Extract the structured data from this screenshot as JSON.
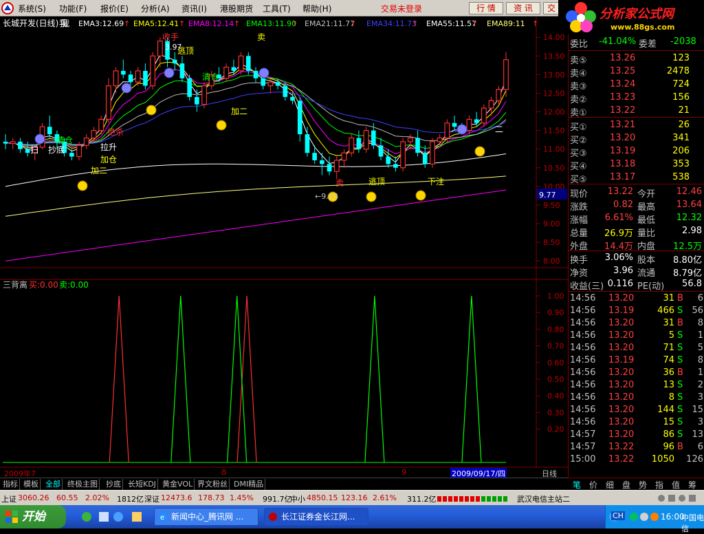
{
  "menubar": {
    "items": [
      "系统(S)",
      "功能(F)",
      "报价(E)",
      "分析(A)",
      "资讯(I)",
      "港股期货",
      "工具(T)",
      "帮助(H)"
    ],
    "login_status": "交易未登录",
    "buttons": [
      "行 情",
      "资 讯",
      "交 易"
    ]
  },
  "brand": {
    "name": "分析家公式网",
    "url": "www.88gs.com"
  },
  "chart": {
    "title": "长城开发(日线) 我",
    "ema_labels": [
      "EMA3:12.69",
      "EMA5:12.41",
      "EMA8:12.14",
      "EMA13:11.90",
      "EMA21:11.77",
      "EMA34:11.73",
      "EMA55:11.57",
      "EMA89:11"
    ],
    "ema_colors": [
      "#ffffff",
      "#ffff00",
      "#ff00ff",
      "#00ff00",
      "#c0c0c0",
      "#4040ff",
      "#ffffff",
      "#ffff80"
    ],
    "price_ticks": [
      "14.00",
      "13.50",
      "13.00",
      "12.50",
      "12.00",
      "11.50",
      "11.00",
      "10.50",
      "10.00",
      "9.50",
      "9.00",
      "8.50",
      "8.00"
    ],
    "current_price_tag": "9.77",
    "high_label": "3.97",
    "low_label": "←9.93",
    "signals": [
      "收手",
      "逃顶",
      "卖",
      "清仓",
      "加二",
      "加仓",
      "拉升",
      "绝杀",
      "抄底",
      "扫",
      "卖",
      "逃顶",
      "二",
      "下注",
      "清仓",
      "加二",
      "我"
    ],
    "indicator": {
      "name": "三背离",
      "sell_label": "买:0.00",
      "buy_label": "卖:0.00",
      "ticks": [
        "1.00",
        "0.90",
        "0.80",
        "0.70",
        "0.60",
        "0.50",
        "0.40",
        "0.30",
        "0.20"
      ]
    },
    "x_labels": [
      "2009年7",
      "8",
      "9",
      "2009/09/17/四"
    ],
    "period": "日线"
  },
  "tabs": [
    "指标",
    "模板",
    "全部",
    "终极主图",
    "抄底",
    "长短KDJ",
    "黄金VOL",
    "界文粉丝",
    "DMI精品"
  ],
  "quote": {
    "ratio": {
      "label1": "委比",
      "val1": "-41.04%",
      "label2": "委差",
      "val2": "-2038"
    },
    "asks": [
      {
        "label": "卖⑤",
        "price": "13.26",
        "vol": "123"
      },
      {
        "label": "卖④",
        "price": "13.25",
        "vol": "2478"
      },
      {
        "label": "卖③",
        "price": "13.24",
        "vol": "724"
      },
      {
        "label": "卖②",
        "price": "13.23",
        "vol": "156"
      },
      {
        "label": "卖①",
        "price": "13.22",
        "vol": "21"
      }
    ],
    "bids": [
      {
        "label": "买①",
        "price": "13.21",
        "vol": "26"
      },
      {
        "label": "买②",
        "price": "13.20",
        "vol": "341"
      },
      {
        "label": "买③",
        "price": "13.19",
        "vol": "206"
      },
      {
        "label": "买④",
        "price": "13.18",
        "vol": "353"
      },
      {
        "label": "买⑤",
        "price": "13.17",
        "vol": "538"
      }
    ],
    "stats1": [
      {
        "l1": "现价",
        "v1": "13.22",
        "c1": "#ff4040",
        "l2": "今开",
        "v2": "12.46",
        "c2": "#ff4040"
      },
      {
        "l1": "涨跌",
        "v1": "0.82",
        "c1": "#ff4040",
        "l2": "最高",
        "v2": "13.64",
        "c2": "#ff4040"
      },
      {
        "l1": "涨幅",
        "v1": "6.61%",
        "c1": "#ff4040",
        "l2": "最低",
        "v2": "12.32",
        "c2": "#00ff00"
      },
      {
        "l1": "总量",
        "v1": "26.9万",
        "c1": "#ffff00",
        "l2": "量比",
        "v2": "2.98",
        "c2": "#ffffff"
      },
      {
        "l1": "外盘",
        "v1": "14.4万",
        "c1": "#ff4040",
        "l2": "内盘",
        "v2": "12.5万",
        "c2": "#00ff00"
      }
    ],
    "stats2": [
      {
        "l1": "换手",
        "v1": "3.06%",
        "l2": "股本",
        "v2": "8.80亿"
      },
      {
        "l1": "净资",
        "v1": "3.96",
        "l2": "流通",
        "v2": "8.79亿"
      },
      {
        "l1": "收益(三)",
        "v1": "0.116",
        "l2": "PE(动)",
        "v2": "56.8"
      }
    ],
    "ticks": [
      {
        "t": "14:56",
        "p": "13.20",
        "v": "31",
        "bs": "B",
        "n": "6"
      },
      {
        "t": "14:56",
        "p": "13.19",
        "v": "466",
        "bs": "S",
        "n": "56"
      },
      {
        "t": "14:56",
        "p": "13.20",
        "v": "31",
        "bs": "B",
        "n": "8"
      },
      {
        "t": "14:56",
        "p": "13.20",
        "v": "5",
        "bs": "S",
        "n": "1"
      },
      {
        "t": "14:56",
        "p": "13.20",
        "v": "71",
        "bs": "S",
        "n": "5"
      },
      {
        "t": "14:56",
        "p": "13.19",
        "v": "74",
        "bs": "S",
        "n": "8"
      },
      {
        "t": "14:56",
        "p": "13.20",
        "v": "36",
        "bs": "B",
        "n": "1"
      },
      {
        "t": "14:56",
        "p": "13.20",
        "v": "13",
        "bs": "S",
        "n": "2"
      },
      {
        "t": "14:56",
        "p": "13.20",
        "v": "8",
        "bs": "S",
        "n": "3"
      },
      {
        "t": "14:56",
        "p": "13.20",
        "v": "144",
        "bs": "S",
        "n": "15"
      },
      {
        "t": "14:56",
        "p": "13.20",
        "v": "15",
        "bs": "S",
        "n": "3"
      },
      {
        "t": "14:57",
        "p": "13.20",
        "v": "86",
        "bs": "S",
        "n": "13"
      },
      {
        "t": "14:57",
        "p": "13.22",
        "v": "96",
        "bs": "B",
        "n": "6"
      },
      {
        "t": "15:00",
        "p": "13.22",
        "v": "1050",
        "bs": "",
        "n": "126"
      }
    ]
  },
  "side_tabs": [
    "笔",
    "价",
    "细",
    "盘",
    "势",
    "指",
    "值",
    "筹"
  ],
  "statusbar": {
    "sh": "上证",
    "sh_idx": "3060.26",
    "sh_chg": "60.55",
    "sh_pct": "2.02%",
    "sh_amt": "1812亿",
    "sz": "深证",
    "sz_idx": "12473.6",
    "sz_chg": "178.73",
    "sz_pct": "1.45%",
    "sz_amt": "991.7亿",
    "zx": "中小",
    "zx_idx": "4850.15",
    "zx_chg": "123.16",
    "zx_pct": "2.61%",
    "zx_amt": "311.2亿",
    "server": "武汉电信主站二"
  },
  "taskbar": {
    "start": "开始",
    "tasks": [
      "新闻中心_腾讯网 ...",
      "长江证券金长江网..."
    ],
    "time": "16:00",
    "carrier": "中国电信",
    "lang": "CH"
  },
  "chart_data": {
    "type": "candlestick",
    "price_range": [
      7.8,
      14.3
    ],
    "candles": [
      [
        11.2,
        11.4,
        11.0,
        11.15
      ],
      [
        11.15,
        11.3,
        11.0,
        11.2
      ],
      [
        11.2,
        11.3,
        10.9,
        11.0
      ],
      [
        11.0,
        11.2,
        10.8,
        10.9
      ],
      [
        10.9,
        11.1,
        10.7,
        11.05
      ],
      [
        11.05,
        11.7,
        11.0,
        11.6
      ],
      [
        11.6,
        11.9,
        11.3,
        11.4
      ],
      [
        11.4,
        11.5,
        11.0,
        11.2
      ],
      [
        11.2,
        11.3,
        10.8,
        10.9
      ],
      [
        10.9,
        11.0,
        10.7,
        10.8
      ],
      [
        10.8,
        11.2,
        10.7,
        11.1
      ],
      [
        11.1,
        11.4,
        11.0,
        11.3
      ],
      [
        11.3,
        11.6,
        11.2,
        11.5
      ],
      [
        11.5,
        11.9,
        11.4,
        11.8
      ],
      [
        11.8,
        12.9,
        11.7,
        12.7
      ],
      [
        12.7,
        13.2,
        12.5,
        13.1
      ],
      [
        13.1,
        13.4,
        12.9,
        13.0
      ],
      [
        13.0,
        13.1,
        12.6,
        12.8
      ],
      [
        12.8,
        13.2,
        12.7,
        13.1
      ],
      [
        13.1,
        13.3,
        12.6,
        12.7
      ],
      [
        12.7,
        13.6,
        12.6,
        13.5
      ],
      [
        13.5,
        14.0,
        13.2,
        13.9
      ],
      [
        13.9,
        14.0,
        13.2,
        13.4
      ],
      [
        13.4,
        13.6,
        13.1,
        13.3
      ],
      [
        13.3,
        13.5,
        12.8,
        12.9
      ],
      [
        12.9,
        13.0,
        12.3,
        12.4
      ],
      [
        12.4,
        12.6,
        12.0,
        12.2
      ],
      [
        12.2,
        12.8,
        12.1,
        12.7
      ],
      [
        12.7,
        13.1,
        12.6,
        13.0
      ],
      [
        13.0,
        13.2,
        12.8,
        12.9
      ],
      [
        12.9,
        13.3,
        12.8,
        13.2
      ],
      [
        13.2,
        13.4,
        13.0,
        13.1
      ],
      [
        13.1,
        13.6,
        13.0,
        13.5
      ],
      [
        13.5,
        13.6,
        13.0,
        13.1
      ],
      [
        13.1,
        13.2,
        12.8,
        12.9
      ],
      [
        12.9,
        13.0,
        12.6,
        12.7
      ],
      [
        12.7,
        12.9,
        12.5,
        12.8
      ],
      [
        12.8,
        12.9,
        12.6,
        12.7
      ],
      [
        12.7,
        12.8,
        12.3,
        12.4
      ],
      [
        12.4,
        12.5,
        12.2,
        12.3
      ],
      [
        12.3,
        12.4,
        11.2,
        11.4
      ],
      [
        11.4,
        11.6,
        10.8,
        10.9
      ],
      [
        10.9,
        11.1,
        10.6,
        10.7
      ],
      [
        10.7,
        10.9,
        10.3,
        10.6
      ],
      [
        10.6,
        10.8,
        10.3,
        10.4
      ],
      [
        10.4,
        10.8,
        10.2,
        10.7
      ],
      [
        10.7,
        11.0,
        10.5,
        10.9
      ],
      [
        10.9,
        11.4,
        10.8,
        11.3
      ],
      [
        11.3,
        11.5,
        10.9,
        11.0
      ],
      [
        11.0,
        11.6,
        10.9,
        11.5
      ],
      [
        11.5,
        11.7,
        11.0,
        11.1
      ],
      [
        11.1,
        11.3,
        10.7,
        10.8
      ],
      [
        10.8,
        11.0,
        10.5,
        10.6
      ],
      [
        10.6,
        10.8,
        10.4,
        10.5
      ],
      [
        10.5,
        11.3,
        10.4,
        11.2
      ],
      [
        11.2,
        11.4,
        11.0,
        11.3
      ],
      [
        11.3,
        11.5,
        10.8,
        10.9
      ],
      [
        10.9,
        11.1,
        10.5,
        10.6
      ],
      [
        10.6,
        11.3,
        10.5,
        11.2
      ],
      [
        11.2,
        11.4,
        11.1,
        11.3
      ],
      [
        11.3,
        11.8,
        11.2,
        11.7
      ],
      [
        11.7,
        11.9,
        11.5,
        11.6
      ],
      [
        11.6,
        11.7,
        11.4,
        11.5
      ],
      [
        11.5,
        11.9,
        11.4,
        11.8
      ],
      [
        11.8,
        12.0,
        11.6,
        11.7
      ],
      [
        11.7,
        12.2,
        11.6,
        12.1
      ],
      [
        12.1,
        12.4,
        11.9,
        12.3
      ],
      [
        12.3,
        12.7,
        12.2,
        12.6
      ],
      [
        12.6,
        13.6,
        12.4,
        13.4
      ]
    ],
    "indicator_sell_peaks": [
      8,
      17,
      43,
      68,
      83,
      97,
      126,
      140
    ],
    "indicator_buy_peaks": [
      56,
      74,
      118,
      149
    ]
  }
}
